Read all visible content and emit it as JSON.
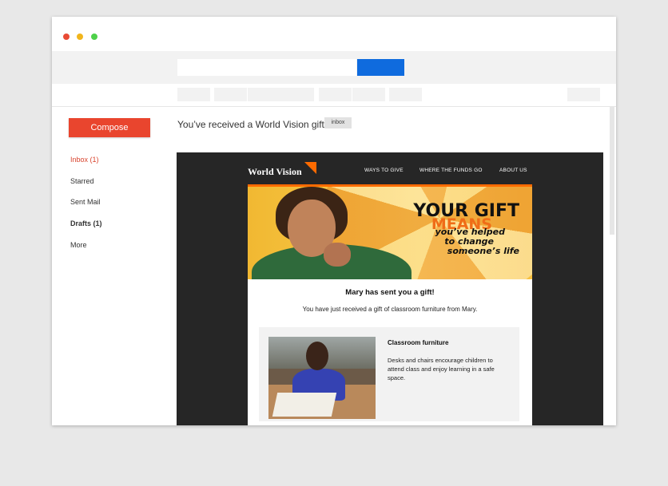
{
  "window": {
    "controls": [
      "close",
      "minimize",
      "maximize"
    ]
  },
  "search": {
    "placeholder": "",
    "button_label": ""
  },
  "sidebar": {
    "compose_label": "Compose",
    "items": [
      {
        "label": "Inbox (1)",
        "active": true,
        "bold": false
      },
      {
        "label": "Starred",
        "active": false,
        "bold": false
      },
      {
        "label": "Sent Mail",
        "active": false,
        "bold": false
      },
      {
        "label": "Drafts (1)",
        "active": false,
        "bold": true
      },
      {
        "label": "More",
        "active": false,
        "bold": false
      }
    ]
  },
  "message": {
    "subject": "You’ve received a World Vision gift",
    "label": "inbox"
  },
  "email": {
    "logo": "World Vision",
    "nav": [
      "WAYS TO GIVE",
      "WHERE THE FUNDS GO",
      "ABOUT US"
    ],
    "hero": {
      "line1": "YOUR GIFT",
      "line2": "MEANS",
      "line3": "you’ve helped",
      "line4": "to change",
      "line5": "someone’s life"
    },
    "gift_title": "Mary has sent you a gift!",
    "gift_sub": "You have just received a gift of classroom furniture from Mary.",
    "card": {
      "title": "Classroom furniture",
      "description": "Desks and chairs encourage children to attend class and enjoy learning in a safe space."
    }
  },
  "colors": {
    "accent_red": "#e9452e",
    "primary_blue": "#0f6bde",
    "brand_orange": "#ff6b00",
    "dark_frame": "#262626"
  }
}
